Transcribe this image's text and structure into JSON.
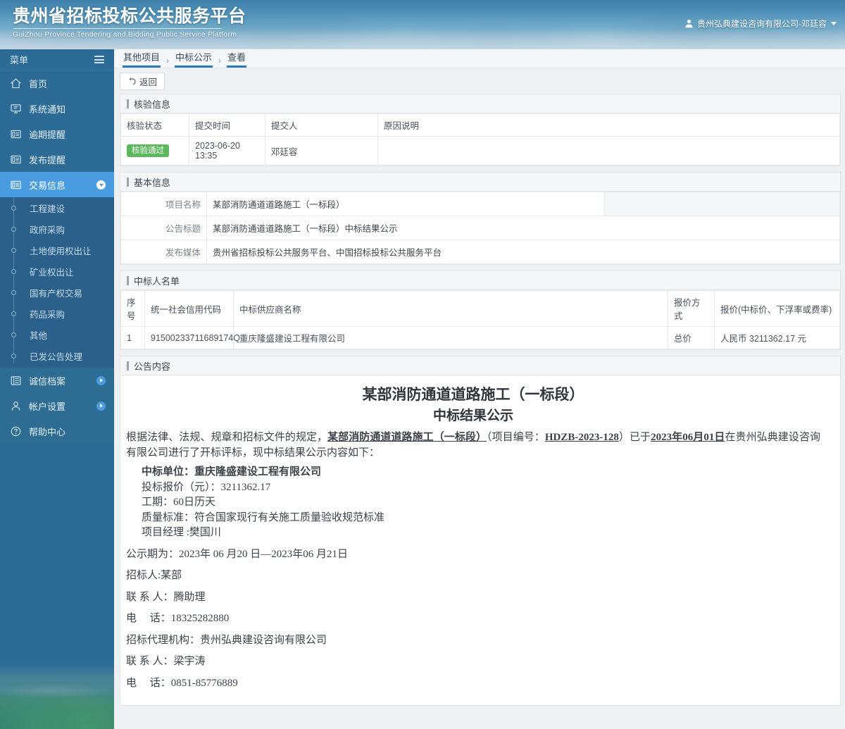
{
  "header": {
    "title_cn": "贵州省招标投标公共服务平台",
    "title_en": "GuiZhou Province Tendering and Bidding Public Service Platform",
    "user": "贵州弘典建设咨询有限公司-邓廷容",
    "user_icon": "user-icon",
    "caret_icon": "caret-down-icon"
  },
  "sidebar": {
    "menu_label": "菜单",
    "burger_icon": "hamburger-icon",
    "items": [
      {
        "label": "首页",
        "icon": "home-icon",
        "active": false,
        "expand": null
      },
      {
        "label": "系统通知",
        "icon": "monitor-icon",
        "active": false,
        "expand": null
      },
      {
        "label": "逾期提醒",
        "icon": "document-icon",
        "active": false,
        "expand": null
      },
      {
        "label": "发布提醒",
        "icon": "document-icon",
        "active": false,
        "expand": null
      },
      {
        "label": "交易信息",
        "icon": "document-icon",
        "active": true,
        "expand": "chevron-down-icon"
      }
    ],
    "sub_items": [
      "工程建设",
      "政府采购",
      "土地使用权出让",
      "矿业权出让",
      "国有产权交易",
      "药品采购",
      "其他",
      "已发公告处理"
    ],
    "items_bottom": [
      {
        "label": "诚信档案",
        "icon": "list-icon",
        "expand": "chevron-right-icon"
      },
      {
        "label": "帐户设置",
        "icon": "person-icon",
        "expand": "chevron-right-icon"
      },
      {
        "label": "帮助中心",
        "icon": "question-icon",
        "expand": null
      }
    ]
  },
  "breadcrumb": {
    "items": [
      "其他项目",
      "中标公示",
      "查看"
    ],
    "separator": "›"
  },
  "toolbar": {
    "back_label": "返回",
    "back_icon": "undo-arrow-icon"
  },
  "verify_section": {
    "title": "核验信息",
    "columns": [
      "核验状态",
      "提交时间",
      "提交人",
      "原因说明"
    ],
    "rows": [
      {
        "status": "核验通过",
        "time": "2023-06-20 13:35",
        "person": "邓廷容",
        "reason": ""
      }
    ],
    "status_color": "#5cb85c"
  },
  "basic_section": {
    "title": "基本信息",
    "fields": [
      {
        "label": "项目名称",
        "value": "某部消防通道道路施工（一标段）"
      },
      {
        "label": "公告标题",
        "value": "某部消防通道道路施工（一标段）中标结果公示"
      },
      {
        "label": "发布媒体",
        "value": "贵州省招标投标公共服务平台、中国招标投标公共服务平台"
      }
    ]
  },
  "winner_section": {
    "title": "中标人名单",
    "columns": [
      "序号",
      "统一社会信用代码",
      "中标供应商名称",
      "报价方式",
      "报价(中标价、下浮率或费率)"
    ],
    "rows": [
      {
        "no": "1",
        "credit_code": "91500233711689174Q",
        "supplier": "重庆隆盛建设工程有限公司",
        "quote_type": "总价",
        "quote": "人民币 3211362.17 元"
      }
    ]
  },
  "announcement": {
    "title": "公告内容",
    "doc_title": "某部消防通道道路施工（一标段）",
    "doc_subtitle": "中标结果公示",
    "para_1a": "根据法律、法规、规章和招标文件的规定，",
    "para_1_project": "某部消防通道道路施工（一标段）",
    "para_1b": "（项目编号：",
    "para_1_code": "HDZB-2023-128",
    "para_1c": "）已于",
    "para_1_date": "2023年06月01日",
    "para_1d": "在贵州弘典建设咨询有限公司进行了开标评标，现中标结果公示内容如下：",
    "line_winner_label": "中标单位：",
    "line_winner_value": "重庆隆盛建设工程有限公司",
    "line_price": "投标报价（元）：3211362.17",
    "line_duration": "工期：60日历天",
    "line_quality": "质量标准：符合国家现行有关施工质量验收规范标准",
    "line_manager": "项目经理 :樊国川",
    "line_period": "公示期为：2023年 06 月20 日—2023年06 月21日",
    "line_tenderer": "招标人:某部",
    "line_contact1": "联 系 人：腾助理",
    "line_phone1": "电　 话：18325282880",
    "line_agency": "招标代理机构：贵州弘典建设咨询有限公司",
    "line_contact2": "联 系 人：梁宇涛",
    "line_phone2": "电　 话：0851-85776889"
  }
}
